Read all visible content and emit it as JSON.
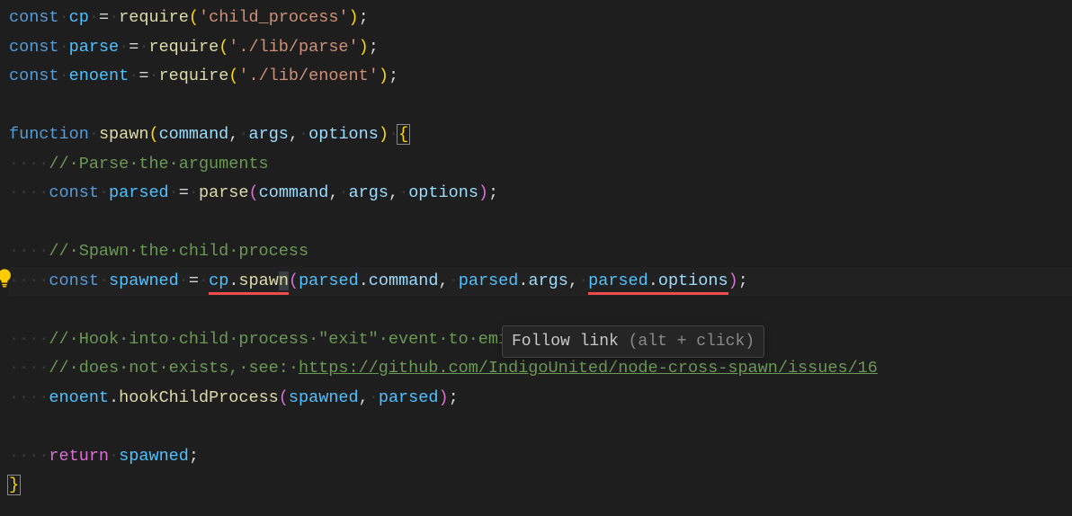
{
  "code": {
    "l1": {
      "kw": "const",
      "ws1": "·",
      "var": "cp",
      "ws2": "·",
      "op": "=",
      "ws3": "·",
      "fn": "require",
      "p1": "(",
      "str": "'child_process'",
      "p2": ")",
      "sc": ";"
    },
    "l2": {
      "kw": "const",
      "ws1": "·",
      "var": "parse",
      "ws2": "·",
      "op": "=",
      "ws3": "·",
      "fn": "require",
      "p1": "(",
      "str": "'./lib/parse'",
      "p2": ")",
      "sc": ";"
    },
    "l3": {
      "kw": "const",
      "ws1": "·",
      "var": "enoent",
      "ws2": "·",
      "op": "=",
      "ws3": "·",
      "fn": "require",
      "p1": "(",
      "str": "'./lib/enoent'",
      "p2": ")",
      "sc": ";"
    },
    "l5": {
      "kw": "function",
      "ws1": "·",
      "fn": "spawn",
      "p1": "(",
      "a1": "command",
      "c1": ",",
      "ws2": "·",
      "a2": "args",
      "c2": ",",
      "ws3": "·",
      "a3": "options",
      "p2": ")",
      "ws4": "·",
      "br": "{"
    },
    "l6": {
      "ind": "····",
      "cm": "//·Parse·the·arguments"
    },
    "l7": {
      "ind": "····",
      "kw": "const",
      "ws1": "·",
      "var": "parsed",
      "ws2": "·",
      "op": "=",
      "ws3": "·",
      "fn": "parse",
      "p1": "(",
      "a1": "command",
      "c1": ",",
      "ws4": "·",
      "a2": "args",
      "c2": ",",
      "ws5": "·",
      "a3": "options",
      "p2": ")",
      "sc": ";"
    },
    "l9": {
      "ind": "····",
      "cm": "//·Spawn·the·child·process"
    },
    "l10": {
      "ind": "····",
      "kw": "const",
      "ws1": "·",
      "var": "spawned",
      "ws2": "·",
      "op": "=",
      "ws3": "·",
      "obj": "cp",
      "dot": ".",
      "m1": "spaw",
      "caret": "n",
      "p1": "(",
      "o1": "parsed",
      "d1": ".",
      "pr1": "command",
      "c1": ",",
      "ws4": "·",
      "o2": "parsed",
      "d2": ".",
      "pr2": "args",
      "c2": ",",
      "ws5": "·",
      "o3": "parsed",
      "d3": ".",
      "pr3": "options",
      "p2": ")",
      "sc": ";"
    },
    "l12": {
      "ind": "····",
      "cm": "//·Hook·into·child·process·\"exit\"·event·to·emit·an·error·if·the·command"
    },
    "l13": {
      "ind": "····",
      "cm1": "//·does·not·exists,·see:·",
      "url": "https://github.com/IndigoUnited/node-cross-spawn/issues/16"
    },
    "l14": {
      "ind": "····",
      "obj": "enoent",
      "dot": ".",
      "fn": "hookChildProcess",
      "p1": "(",
      "a1": "spawned",
      "c1": ",",
      "ws1": "·",
      "a2": "parsed",
      "p2": ")",
      "sc": ";"
    },
    "l16": {
      "ind": "····",
      "kw": "return",
      "ws1": "·",
      "var": "spawned",
      "sc": ";"
    },
    "l17": {
      "br": "}"
    }
  },
  "tooltip": {
    "label": "Follow link",
    "hint": " (alt + click)"
  }
}
